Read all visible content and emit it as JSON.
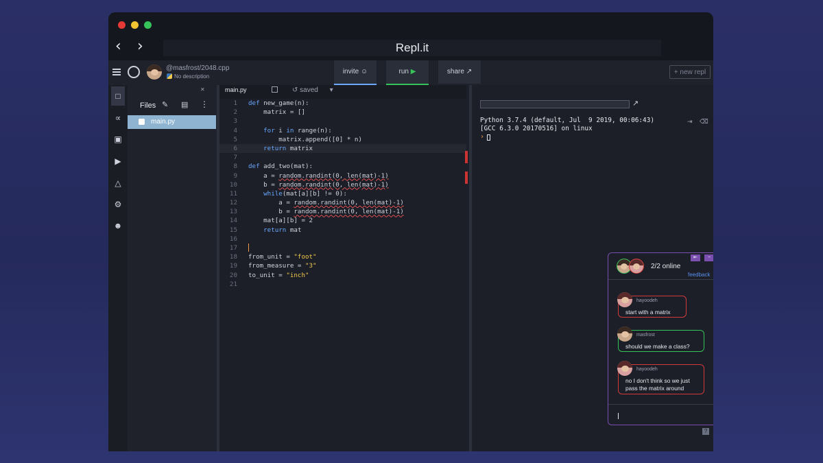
{
  "window": {
    "title": "Repl.it",
    "traffic_lights": [
      "#e53935",
      "#f2c230",
      "#35c35a"
    ]
  },
  "nav": {
    "back": "‹",
    "forward": "›"
  },
  "repl": {
    "name": "@masfrost/2048.cpp",
    "description": "No description"
  },
  "toolbar": {
    "invite_label": "invite",
    "run_label": "run",
    "share_label": "share",
    "new_repl_label": "+ new repl",
    "run_color": "#35c35a"
  },
  "sidebar_icons": [
    "file-icon",
    "share-nodes-icon",
    "cube-icon",
    "debugger-icon",
    "flask-icon",
    "gear-icon",
    "alien-icon"
  ],
  "files": {
    "label": "Files",
    "items": [
      {
        "name": "main.py"
      }
    ]
  },
  "editor": {
    "tab": "main.py",
    "status": "saved",
    "lines": [
      {
        "n": "1",
        "html": "<span class='kw'>def</span> new_game(n):"
      },
      {
        "n": "2",
        "html": "    matrix = []"
      },
      {
        "n": "3",
        "html": ""
      },
      {
        "n": "4",
        "html": "    <span class='kw'>for</span> i <span class='kw'>in</span> range(n):"
      },
      {
        "n": "5",
        "html": "        matrix.append([0] * n)"
      },
      {
        "n": "6",
        "html": "    <span class='kw'>return</span> matrix"
      },
      {
        "n": "7",
        "html": ""
      },
      {
        "n": "8",
        "html": "<span class='kw'>def</span> add_two(mat):"
      },
      {
        "n": "9",
        "html": "    a = <span class='err'>random.randint(0, len(mat)-1)</span>"
      },
      {
        "n": "10",
        "html": "    b = <span class='err'>random.randint(0, len(mat)-1)</span>"
      },
      {
        "n": "11",
        "html": "    <span class='kw'>while</span>(mat[a][b] != 0):"
      },
      {
        "n": "12",
        "html": "        a = <span class='err'>random.randint(0, len(mat)-1)</span>"
      },
      {
        "n": "13",
        "html": "        b = <span class='err'>random.randint(0, len(mat)-1)</span>"
      },
      {
        "n": "14",
        "html": "    mat[a][b] = 2"
      },
      {
        "n": "15",
        "html": "    <span class='kw'>return</span> mat"
      },
      {
        "n": "16",
        "html": ""
      },
      {
        "n": "17",
        "html": ""
      },
      {
        "n": "18",
        "html": "from_unit = <span class='str'>\"foot\"</span>"
      },
      {
        "n": "19",
        "html": "from_measure = <span class='str'>\"3\"</span>"
      },
      {
        "n": "20",
        "html": "to_unit = <span class='str'>\"inch\"</span>"
      },
      {
        "n": "21",
        "html": ""
      }
    ],
    "current_line": "6"
  },
  "console": {
    "output": "Python 3.7.4 (default, Jul  9 2019, 00:06:43)\n[GCC 6.3.0 20170516] on linux",
    "prompt": "›"
  },
  "chat": {
    "online": "2/2 online",
    "feedback": "feedback",
    "messages": [
      {
        "user": "hayoodeh",
        "text": "start with a matrix",
        "color": "#d23b3b"
      },
      {
        "user": "masfrost",
        "text": "should we make a class?",
        "color": "#35c35a"
      },
      {
        "user": "hayoodeh",
        "text": "no I don't think so we just\npass the matrix around",
        "color": "#d23b3b"
      }
    ]
  }
}
